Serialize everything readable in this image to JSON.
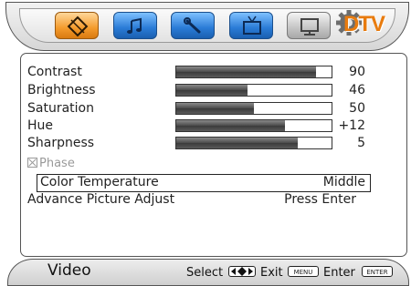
{
  "tabs": [
    {
      "name": "picture",
      "icon": "picture-adjust-icon",
      "active": true
    },
    {
      "name": "sound",
      "icon": "music-note-icon",
      "active": false
    },
    {
      "name": "setup",
      "icon": "wrench-icon",
      "active": false
    },
    {
      "name": "tv",
      "icon": "tv-icon",
      "active": false
    },
    {
      "name": "pc",
      "icon": "monitor-icon",
      "active": false
    }
  ],
  "brand_logo": "DTV",
  "settings": [
    {
      "label": "Contrast",
      "value": "90",
      "level": 0.9
    },
    {
      "label": "Brightness",
      "value": "46",
      "level": 0.46
    },
    {
      "label": "Saturation",
      "value": "50",
      "level": 0.5
    },
    {
      "label": "Hue",
      "value": "+12",
      "level": 0.7
    },
    {
      "label": "Sharpness",
      "value": "5",
      "level": 0.78
    }
  ],
  "phase_label": "Phase",
  "color_temperature": {
    "label": "Color Temperature",
    "value": "Middle"
  },
  "advance_picture": {
    "label": "Advance Picture Adjust",
    "value": "Press Enter"
  },
  "footer": {
    "section": "Video",
    "select_label": "Select",
    "exit_label": "Exit",
    "menu_key": "MENU",
    "enter_label": "Enter",
    "enter_key": "ENTER"
  },
  "colors": {
    "active_tab": "#f49b2c",
    "tab": "#2a7bd6",
    "logo": "#e87b0e"
  }
}
